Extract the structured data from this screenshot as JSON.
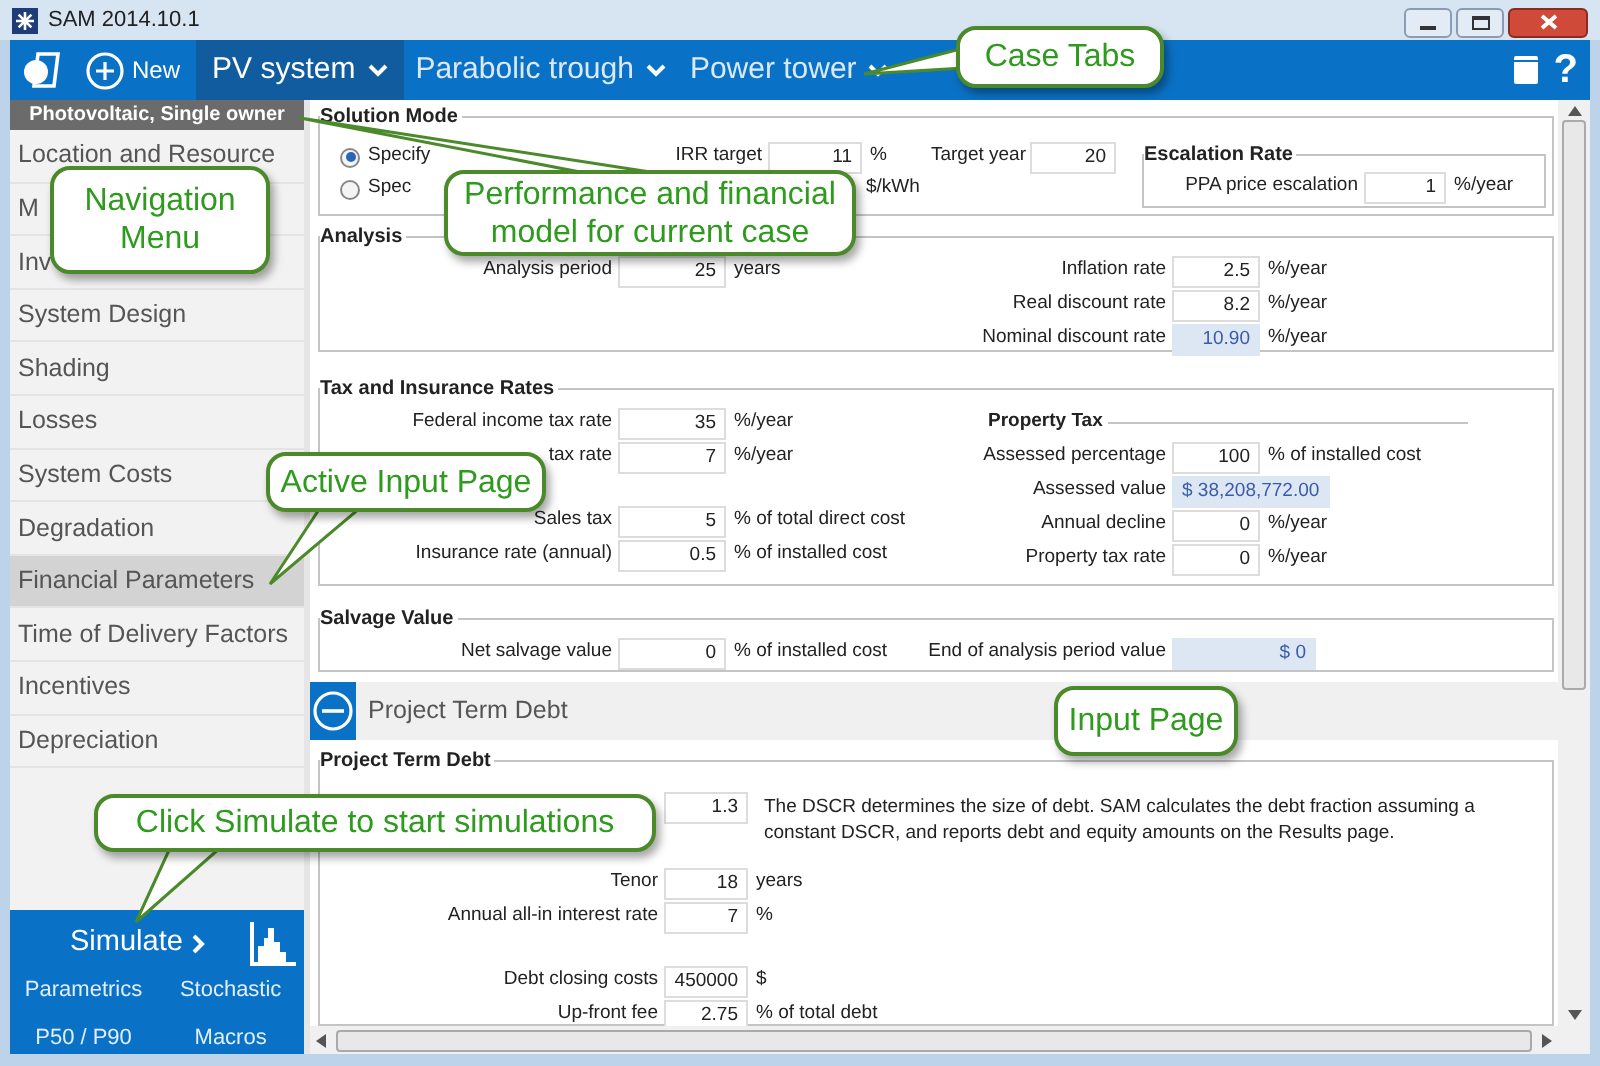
{
  "window": {
    "title": "SAM 2014.10.1"
  },
  "toolbar": {
    "new_label": "New",
    "help_label": "?",
    "tabs": [
      {
        "label": "PV system",
        "selected": true
      },
      {
        "label": "Parabolic trough",
        "selected": false
      },
      {
        "label": "Power tower",
        "selected": false
      }
    ]
  },
  "sidebar": {
    "header": "Photovoltaic, Single owner",
    "items": [
      {
        "label": "Location and Resource",
        "selected": false
      },
      {
        "label": "M",
        "selected": false
      },
      {
        "label": "Inv",
        "selected": false
      },
      {
        "label": "System Design",
        "selected": false
      },
      {
        "label": "Shading",
        "selected": false
      },
      {
        "label": "Losses",
        "selected": false
      },
      {
        "label": "System Costs",
        "selected": false
      },
      {
        "label": "Degradation",
        "selected": false
      },
      {
        "label": "Financial Parameters",
        "selected": true
      },
      {
        "label": "Time of Delivery Factors",
        "selected": false
      },
      {
        "label": "Incentives",
        "selected": false
      },
      {
        "label": "Depreciation",
        "selected": false
      }
    ]
  },
  "simulate": {
    "label": "Simulate",
    "links": [
      "Parametrics",
      "Stochastic",
      "P50 / P90",
      "Macros"
    ]
  },
  "solution_mode": {
    "title": "Solution Mode",
    "options": [
      {
        "label": "Specify",
        "selected": true
      },
      {
        "label": "Spec",
        "selected": false
      }
    ],
    "irr_target": {
      "label": "IRR target",
      "value": "11",
      "unit": "%"
    },
    "target_year": {
      "label": "Target year",
      "value": "20"
    },
    "ppa_unit": "$/kWh"
  },
  "escalation_rate": {
    "title": "Escalation Rate",
    "field": {
      "label": "PPA price escalation",
      "value": "1",
      "unit": "%/year"
    }
  },
  "sections": [
    {
      "title": "Analysis",
      "left": [
        {
          "label": "Analysis period",
          "value": "25",
          "unit": "years",
          "kind": "input"
        }
      ],
      "right": [
        {
          "label": "Inflation rate",
          "value": "2.5",
          "unit": "%/year",
          "kind": "input"
        },
        {
          "label": "Real discount rate",
          "value": "8.2",
          "unit": "%/year",
          "kind": "input"
        },
        {
          "label": "Nominal discount rate",
          "value": "10.90",
          "unit": "%/year",
          "kind": "computed"
        }
      ]
    },
    {
      "title": "Tax and Insurance Rates",
      "left": [
        {
          "label": "Federal income tax rate",
          "value": "35",
          "unit": "%/year",
          "kind": "input"
        },
        {
          "label": "tax rate",
          "value": "7",
          "unit": "%/year",
          "kind": "input"
        },
        {
          "label": "Sales tax",
          "value": "5",
          "unit": "% of total direct cost",
          "kind": "input",
          "spaced": true
        },
        {
          "label": "Insurance rate (annual)",
          "value": "0.5",
          "unit": "% of installed cost",
          "kind": "input"
        }
      ],
      "right_heading": "Property Tax",
      "right": [
        {
          "label": "Assessed percentage",
          "value": "100",
          "unit": "% of installed cost",
          "kind": "input"
        },
        {
          "label": "Assessed value",
          "value": "$ 38,208,772.00",
          "kind": "computed"
        },
        {
          "label": "Annual decline",
          "value": "0",
          "unit": "%/year",
          "kind": "input"
        },
        {
          "label": "Property tax rate",
          "value": "0",
          "unit": "%/year",
          "kind": "input"
        }
      ]
    },
    {
      "title": "Salvage Value",
      "left": [
        {
          "label": "Net salvage value",
          "value": "0",
          "unit": "% of installed cost",
          "kind": "input"
        }
      ],
      "right": [
        {
          "label": "End of analysis period value",
          "value": "$ 0",
          "kind": "computed"
        }
      ]
    }
  ],
  "debt_header": {
    "label": "Project Term Debt",
    "expanded": true
  },
  "debt_section": {
    "title": "Project Term Debt",
    "note": "The DSCR determines the size of debt. SAM calculates the debt fraction assuming a constant DSCR, and reports debt and equity amounts on the Results page.",
    "fields": [
      {
        "value": "1.3",
        "kind": "input"
      },
      {
        "label": "Tenor",
        "value": "18",
        "unit": "years",
        "kind": "input",
        "spaced": true
      },
      {
        "label": "Annual all-in interest rate",
        "value": "7",
        "unit": "%",
        "kind": "input"
      },
      {
        "label": "Debt closing costs",
        "value": "450000",
        "unit": "$",
        "kind": "input",
        "spaced": true
      },
      {
        "label": "Up-front fee",
        "value": "2.75",
        "unit": "% of total debt",
        "kind": "input"
      }
    ]
  },
  "callouts": [
    {
      "text": "Case Tabs"
    },
    {
      "text": "Navigation Menu"
    },
    {
      "text": "Performance and financial model for current case"
    },
    {
      "text": "Active Input Page"
    },
    {
      "text": "Input Page"
    },
    {
      "text": "Click Simulate to start simulations"
    }
  ]
}
